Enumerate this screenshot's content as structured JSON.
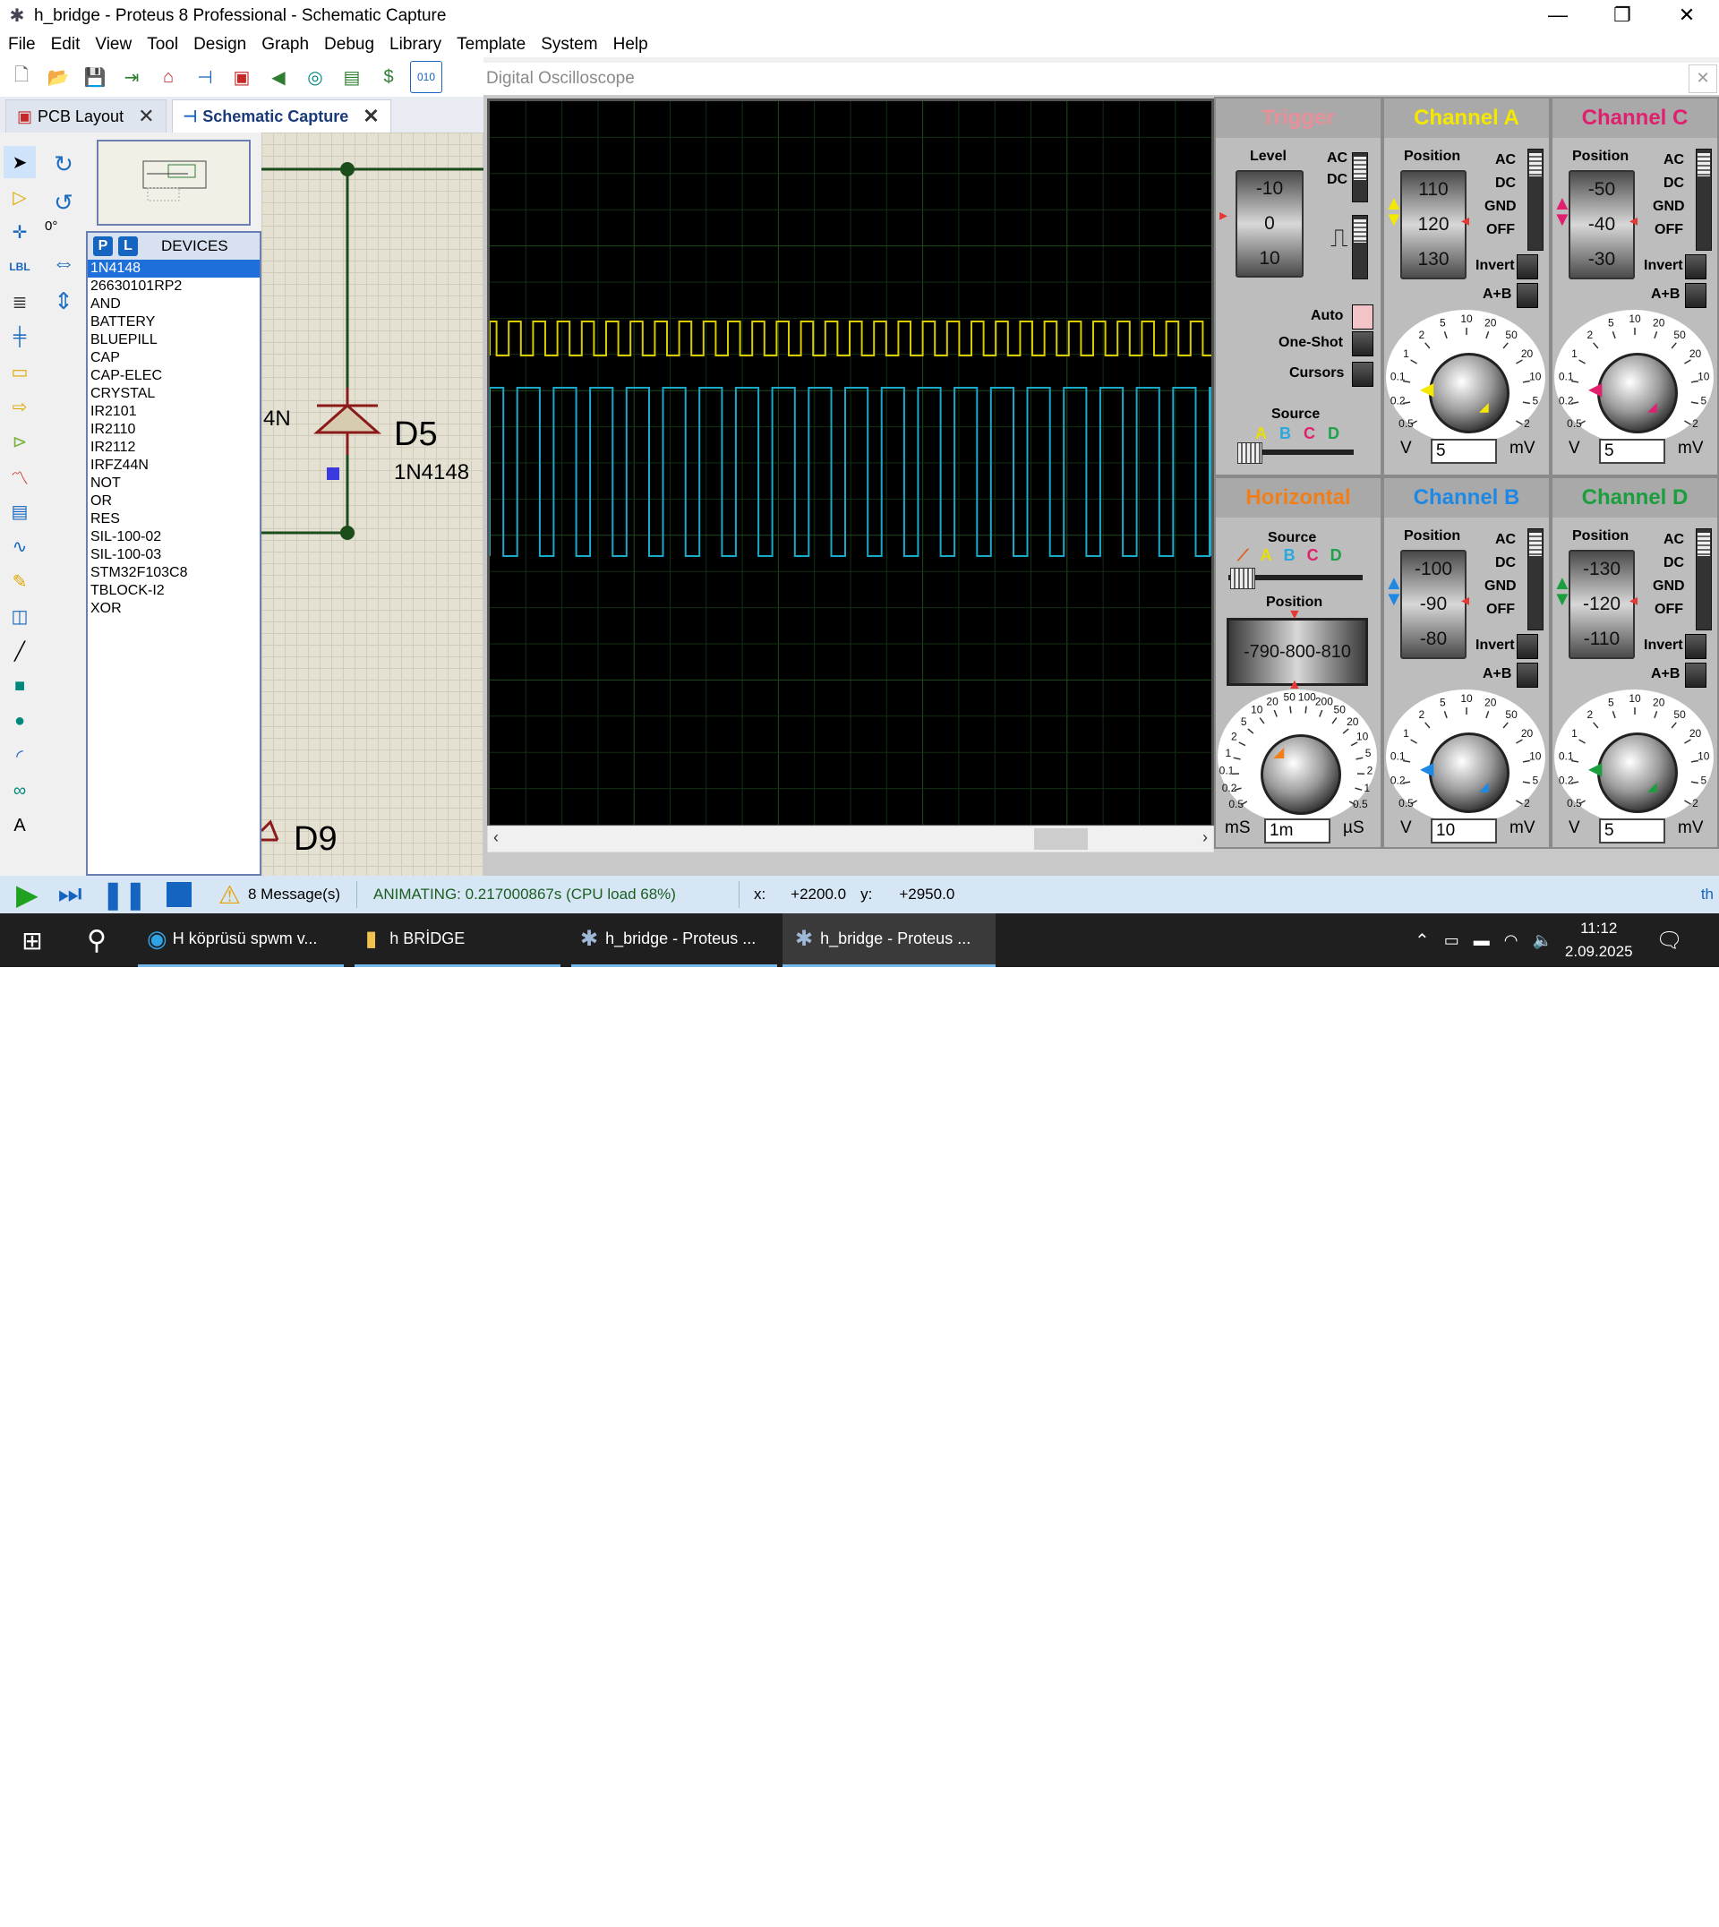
{
  "window": {
    "title": "h_bridge - Proteus 8 Professional - Schematic Capture",
    "minimize": "—",
    "restore": "❐",
    "close": "✕"
  },
  "menu": [
    "File",
    "Edit",
    "View",
    "Tool",
    "Design",
    "Graph",
    "Debug",
    "Library",
    "Template",
    "System",
    "Help"
  ],
  "tabs": [
    {
      "label": "PCB Layout",
      "close": "✕"
    },
    {
      "label": "Schematic Capture",
      "close": "✕"
    }
  ],
  "rotation": "0°",
  "devices": {
    "p_btn": "P",
    "l_btn": "L",
    "header": "DEVICES",
    "items": [
      "1N4148",
      "26630101RP2",
      "AND",
      "BATTERY",
      "BLUEPILL",
      "CAP",
      "CAP-ELEC",
      "CRYSTAL",
      "IR2101",
      "IR2110",
      "IR2112",
      "IRFZ44N",
      "NOT",
      "OR",
      "RES",
      "SIL-100-02",
      "SIL-100-03",
      "STM32F103C8",
      "TBLOCK-I2",
      "XOR"
    ],
    "selected": "1N4148"
  },
  "schematic": {
    "part_fragment": "4N",
    "d5_ref": "D5",
    "d5_value": "1N4148",
    "d9_ref": "D9"
  },
  "oscilloscope": {
    "title": "Digital Oscilloscope",
    "trigger": {
      "header": "Trigger",
      "level_label": "Level",
      "level_values": [
        "-10",
        "0",
        "10"
      ],
      "ac": "AC",
      "dc": "DC",
      "auto": "Auto",
      "one_shot": "One-Shot",
      "cursors": "Cursors",
      "source_label": "Source",
      "sources": [
        "A",
        "B",
        "C",
        "D"
      ]
    },
    "horizontal": {
      "header": "Horizontal",
      "source_label": "Source",
      "sources": [
        "A",
        "B",
        "C",
        "D"
      ],
      "position_label": "Position",
      "position_values": "-790-800-810",
      "dial_labels": [
        "0.5",
        "0.2",
        "0.1",
        "1",
        "2",
        "5",
        "10",
        "20",
        "50",
        "100",
        "200",
        "50",
        "20",
        "10",
        "5",
        "2",
        "1",
        "0.5"
      ],
      "value": "1m",
      "unit_left": "mS",
      "unit_right": "µS"
    },
    "channels": [
      {
        "name": "Channel A",
        "color": "#f5e800",
        "position_label": "Position",
        "position_values": [
          "110",
          "120",
          "130"
        ],
        "coupling": [
          "AC",
          "DC",
          "GND",
          "OFF"
        ],
        "invert": "Invert",
        "sum": "A+B",
        "value": "5",
        "unit_left": "V",
        "unit_right": "mV"
      },
      {
        "name": "Channel C",
        "color": "#e0206e",
        "position_label": "Position",
        "position_values": [
          "-50",
          "-40",
          "-30"
        ],
        "coupling": [
          "AC",
          "DC",
          "GND",
          "OFF"
        ],
        "invert": "Invert",
        "sum": "A+B",
        "value": "5",
        "unit_left": "V",
        "unit_right": "mV"
      },
      {
        "name": "Channel B",
        "color": "#1e88e5",
        "position_label": "Position",
        "position_values": [
          "-100",
          "-90",
          "-80"
        ],
        "coupling": [
          "AC",
          "DC",
          "GND",
          "OFF"
        ],
        "invert": "Invert",
        "sum": "A+B",
        "value": "10",
        "unit_left": "V",
        "unit_right": "mV"
      },
      {
        "name": "Channel D",
        "color": "#1b9e3e",
        "position_label": "Position",
        "position_values": [
          "-130",
          "-120",
          "-110"
        ],
        "coupling": [
          "AC",
          "DC",
          "GND",
          "OFF"
        ],
        "invert": "Invert",
        "sum": "A+B",
        "value": "5",
        "unit_left": "V",
        "unit_right": "mV"
      }
    ],
    "vdial_labels": [
      "0.5",
      "0.2",
      "0.1",
      "1",
      "2",
      "5",
      "10",
      "20",
      "50",
      "20",
      "10",
      "5",
      "2"
    ],
    "trace_colors": {
      "a": "#d8cc00",
      "b": "#1aa9c9"
    }
  },
  "status": {
    "messages": "8 Message(s)",
    "animating": "ANIMATING: 0.217000867s (CPU load 68%)",
    "x_label": "x:",
    "x_value": "+2200.0",
    "y_label": "y:",
    "y_value": "+2950.0",
    "right_fragment": "th"
  },
  "taskbar": {
    "items": [
      "H köprüsü spwm v...",
      "h BRİDGE",
      "h_bridge - Proteus ...",
      "h_bridge - Proteus ..."
    ],
    "time": "11:12",
    "date": "2.09.2025"
  }
}
